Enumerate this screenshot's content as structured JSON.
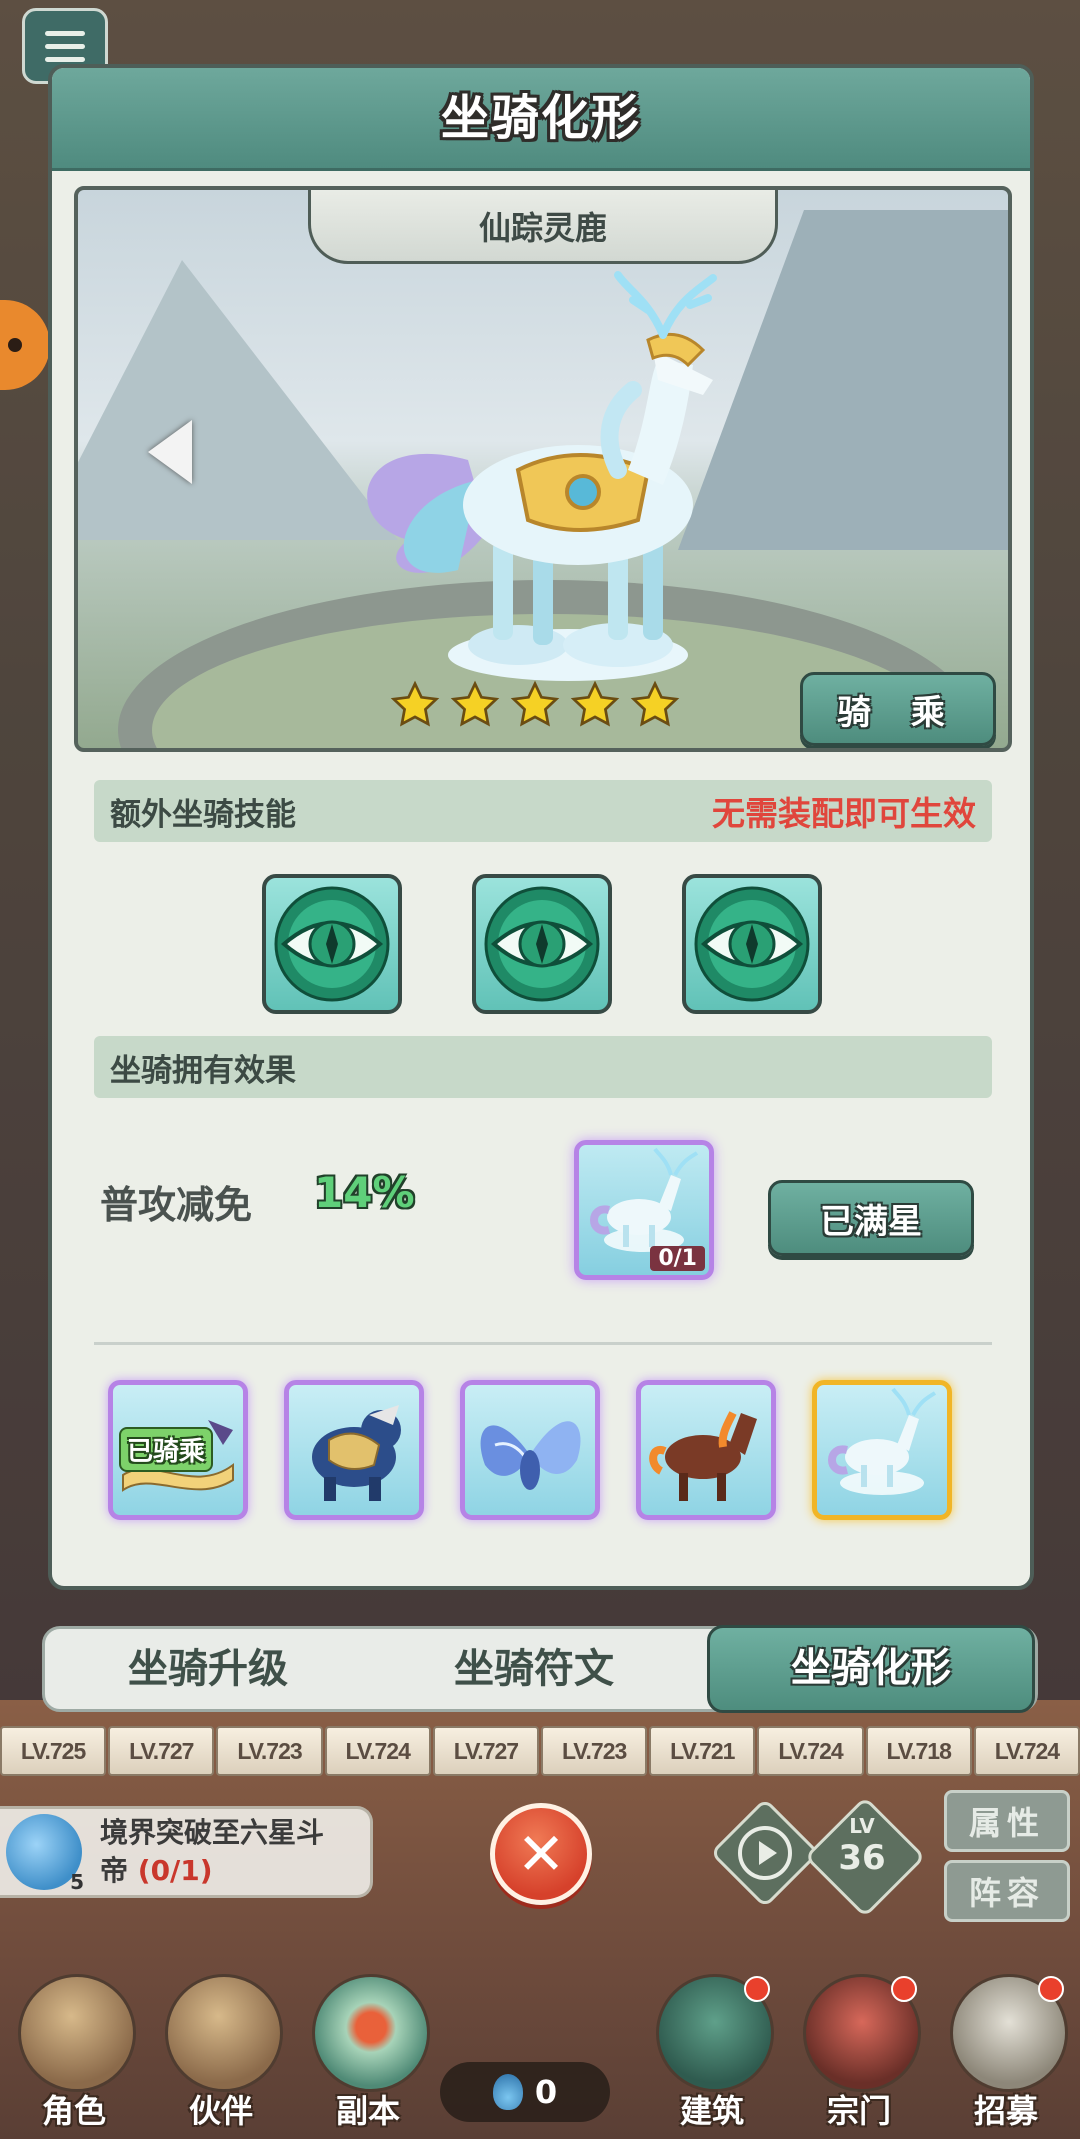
{
  "panel": {
    "title": "坐骑化形"
  },
  "showcase": {
    "mount_name": "仙踪灵鹿",
    "stars": 5,
    "ride_button": "骑  乘"
  },
  "skills_section": {
    "title": "额外坐骑技能",
    "note": "无需装配即可生效",
    "skills": [
      "eye-skill-icon",
      "eye-skill-icon",
      "eye-skill-icon"
    ]
  },
  "effect_section": {
    "title": "坐骑拥有效果",
    "effect_label": "普攻减免",
    "effect_value": "14%",
    "fragment_count": "0/1",
    "max_star_button": "已满星"
  },
  "mount_list": {
    "ridden_label": "已骑乘",
    "items": [
      "dragon-mount",
      "armored-beast-mount",
      "butterfly-bird-mount",
      "fire-horse-mount",
      "spirit-deer-mount"
    ],
    "selected_index": 4
  },
  "tabs": {
    "upgrade": "坐骑升级",
    "rune": "坐骑符文",
    "transform": "坐骑化形"
  },
  "hero_levels": [
    "LV.725",
    "LV.727",
    "LV.723",
    "LV.724",
    "LV.727",
    "LV.723",
    "LV.721",
    "LV.724",
    "LV.718",
    "LV.724"
  ],
  "task": {
    "text": "境界突破至六星斗",
    "text2": "帝",
    "progress": "(0/1)",
    "badge": "5"
  },
  "level_badge": {
    "prefix": "LV",
    "value": "36"
  },
  "side_buttons": {
    "attributes": "属性",
    "lineup": "阵容"
  },
  "currency": {
    "value": "0"
  },
  "bottom_nav": {
    "role": "角色",
    "partner": "伙伴",
    "dungeon": "副本",
    "building": "建筑",
    "sect": "宗门",
    "recruit": "招募"
  },
  "colors": {
    "accent_teal": "#5a9a8c",
    "warning_red": "#e0463c",
    "value_green": "#5fd07a",
    "star_gold": "#f5d125"
  }
}
